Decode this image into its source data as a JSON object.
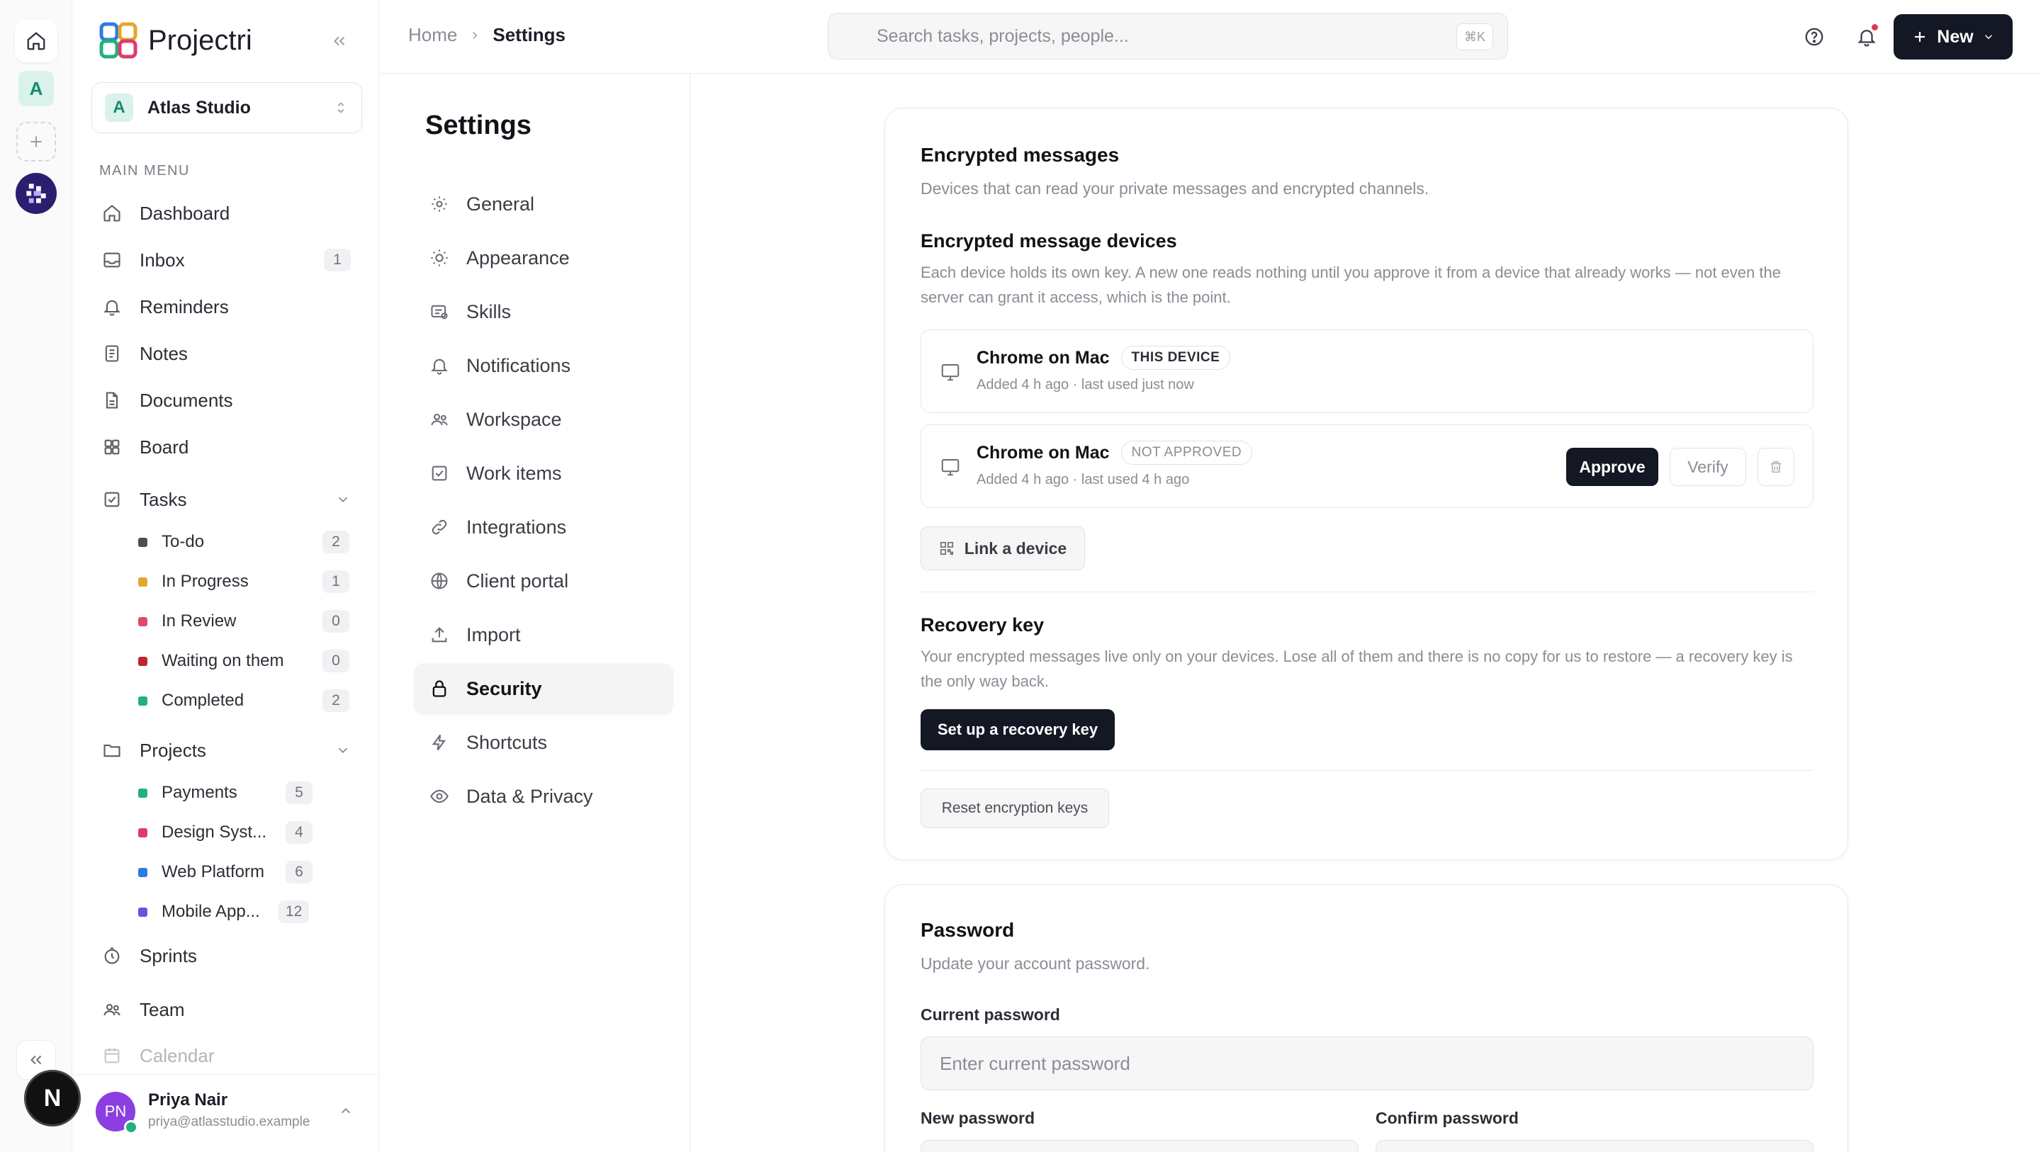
{
  "app": {
    "name": "Projectri"
  },
  "rail": {
    "workspace_initial": "A",
    "bottom_avatar_initial": "N"
  },
  "workspace": {
    "initial": "A",
    "name": "Atlas Studio"
  },
  "sidebar": {
    "section_label": "MAIN MENU",
    "items": [
      {
        "label": "Dashboard",
        "icon": "home-icon"
      },
      {
        "label": "Inbox",
        "icon": "inbox-icon",
        "badge": "1"
      },
      {
        "label": "Reminders",
        "icon": "bell-icon"
      },
      {
        "label": "Notes",
        "icon": "notes-icon"
      },
      {
        "label": "Documents",
        "icon": "document-icon"
      },
      {
        "label": "Board",
        "icon": "board-icon"
      },
      {
        "label": "Tasks",
        "icon": "checkbox-icon"
      },
      {
        "label": "Projects",
        "icon": "folder-icon"
      },
      {
        "label": "Sprints",
        "icon": "timer-icon"
      },
      {
        "label": "Team",
        "icon": "team-icon"
      },
      {
        "label": "Calendar",
        "icon": "calendar-icon"
      }
    ],
    "tasks": [
      {
        "label": "To-do",
        "count": "2",
        "color": "#4b4f58"
      },
      {
        "label": "In Progress",
        "count": "1",
        "color": "#e0a82e"
      },
      {
        "label": "In Review",
        "count": "0",
        "color": "#e04a6a"
      },
      {
        "label": "Waiting on them",
        "count": "0",
        "color": "#c0262d"
      },
      {
        "label": "Completed",
        "count": "2",
        "color": "#22b07d"
      }
    ],
    "projects": [
      {
        "label": "Payments",
        "count": "5",
        "color": "#22b07d"
      },
      {
        "label": "Design Syst...",
        "count": "4",
        "color": "#e03a6a"
      },
      {
        "label": "Web Platform",
        "count": "6",
        "color": "#2f7be0"
      },
      {
        "label": "Mobile App...",
        "count": "12",
        "color": "#6a4fe0"
      }
    ]
  },
  "user": {
    "initials": "PN",
    "name": "Priya Nair",
    "email": "priya@atlasstudio.example"
  },
  "header": {
    "breadcrumb_home": "Home",
    "breadcrumb_current": "Settings",
    "search_placeholder": "Search tasks, projects, people...",
    "search_shortcut": "⌘K",
    "new_label": "New"
  },
  "settings": {
    "title": "Settings",
    "nav": [
      {
        "label": "General",
        "icon": "gear-icon"
      },
      {
        "label": "Appearance",
        "icon": "sun-icon"
      },
      {
        "label": "Skills",
        "icon": "skills-icon"
      },
      {
        "label": "Notifications",
        "icon": "bell-icon"
      },
      {
        "label": "Workspace",
        "icon": "people-icon"
      },
      {
        "label": "Work items",
        "icon": "checkbox-icon"
      },
      {
        "label": "Integrations",
        "icon": "link-icon"
      },
      {
        "label": "Client portal",
        "icon": "globe-icon"
      },
      {
        "label": "Import",
        "icon": "upload-icon"
      },
      {
        "label": "Security",
        "icon": "lock-icon",
        "active": true
      },
      {
        "label": "Shortcuts",
        "icon": "bolt-icon"
      },
      {
        "label": "Data & Privacy",
        "icon": "eye-icon"
      }
    ]
  },
  "encrypted": {
    "title": "Encrypted messages",
    "description": "Devices that can read your private messages and encrypted channels.",
    "devices_title": "Encrypted message devices",
    "devices_description": "Each device holds its own key. A new one reads nothing until you approve it from a device that already works — not even the server can grant it access, which is the point.",
    "devices": [
      {
        "name": "Chrome on Mac",
        "tag": "THIS DEVICE",
        "meta": "Added 4 h ago · last used just now"
      },
      {
        "name": "Chrome on Mac",
        "tag": "NOT APPROVED",
        "meta": "Added 4 h ago · last used 4 h ago",
        "approve_label": "Approve",
        "verify_label": "Verify"
      }
    ],
    "link_device_label": "Link a device",
    "recovery_title": "Recovery key",
    "recovery_description": "Your encrypted messages live only on your devices. Lose all of them and there is no copy for us to restore — a recovery key is the only way back.",
    "recovery_button": "Set up a recovery key",
    "reset_button": "Reset encryption keys"
  },
  "password": {
    "title": "Password",
    "description": "Update your account password.",
    "current_label": "Current password",
    "current_placeholder": "Enter current password",
    "new_label": "New password",
    "confirm_label": "Confirm password"
  }
}
